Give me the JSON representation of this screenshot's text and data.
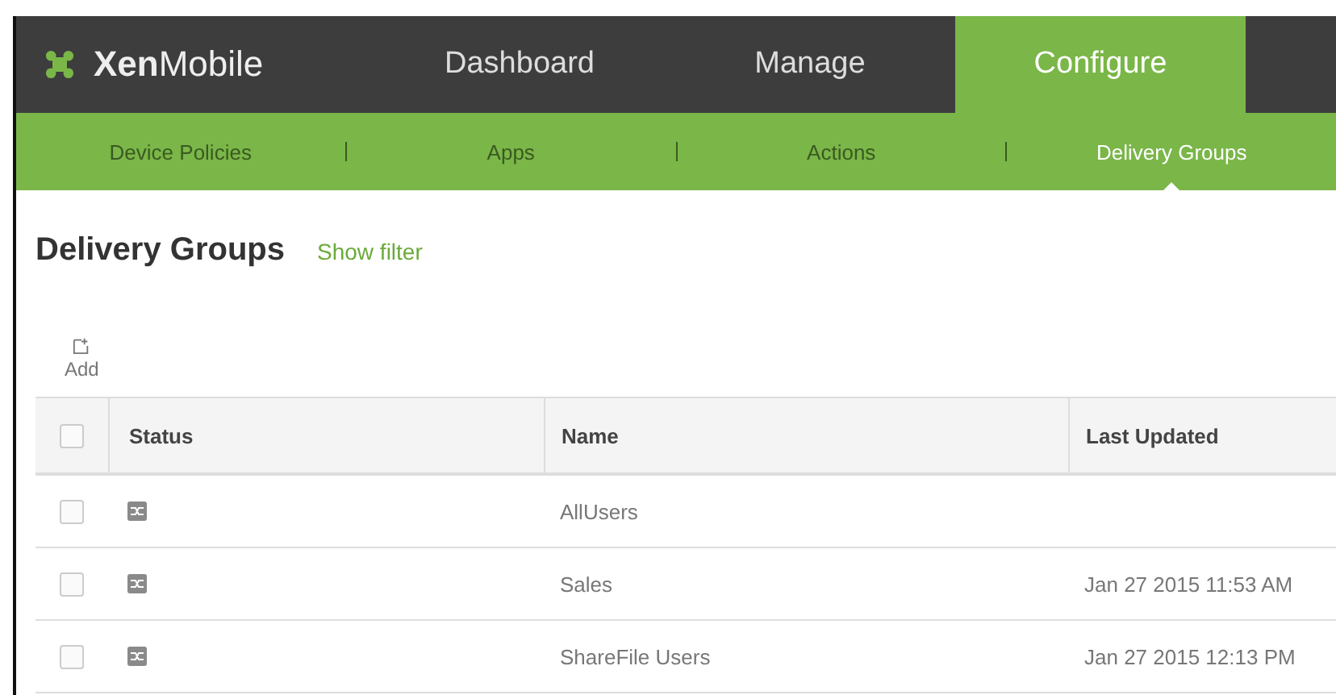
{
  "brand": {
    "bold": "Xen",
    "light": "Mobile"
  },
  "nav": [
    {
      "label": "Dashboard",
      "selected": false
    },
    {
      "label": "Manage",
      "selected": false
    },
    {
      "label": "Configure",
      "selected": true
    }
  ],
  "subnav": [
    {
      "label": "Device Policies",
      "selected": false
    },
    {
      "label": "Apps",
      "selected": false
    },
    {
      "label": "Actions",
      "selected": false
    },
    {
      "label": "Delivery Groups",
      "selected": true
    }
  ],
  "page": {
    "title": "Delivery Groups",
    "filter_link": "Show filter"
  },
  "toolbar": {
    "add": "Add"
  },
  "table": {
    "columns": [
      "Status",
      "Name",
      "Last Updated"
    ],
    "all_checked": false,
    "rows": [
      {
        "checked": false,
        "name": "AllUsers",
        "last_updated": ""
      },
      {
        "checked": false,
        "name": "Sales",
        "last_updated": "Jan 27 2015 11:53 AM"
      },
      {
        "checked": false,
        "name": "ShareFile Users",
        "last_updated": "Jan 27 2015 12:13 PM"
      }
    ]
  }
}
